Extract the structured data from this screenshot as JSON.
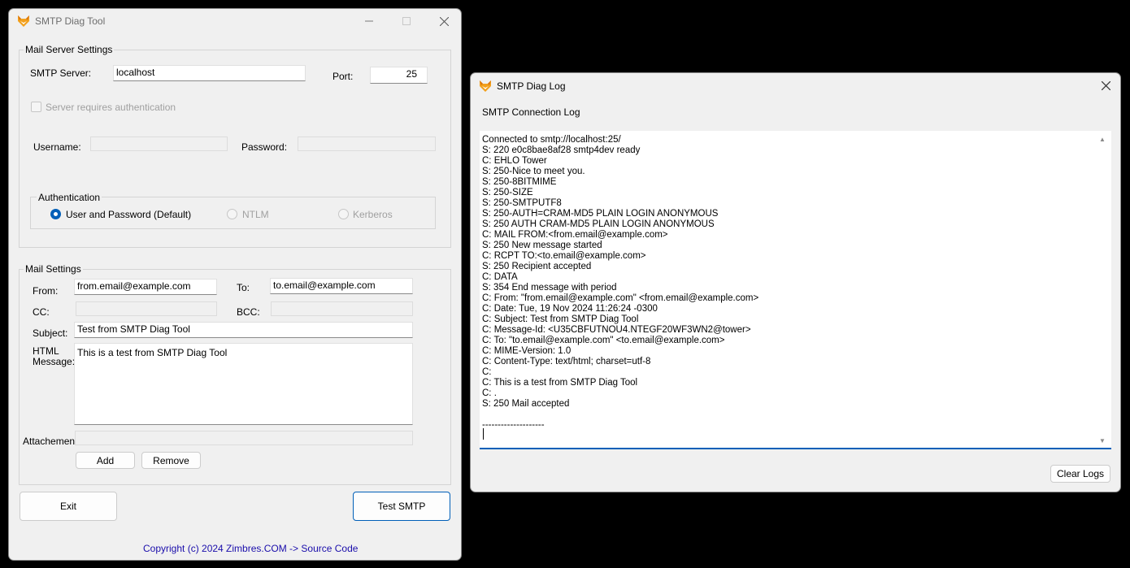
{
  "main_window": {
    "title": "SMTP Diag Tool",
    "server_group": {
      "title": "Mail Server Settings",
      "smtp_server_label": "SMTP Server:",
      "smtp_server_value": "localhost",
      "port_label": "Port:",
      "port_value": "25",
      "auth_checkbox_label": "Server requires authentication",
      "username_label": "Username:",
      "password_label": "Password:",
      "auth_group": {
        "title": "Authentication",
        "options": [
          "User and Password (Default)",
          "NTLM",
          "Kerberos"
        ],
        "selected": "User and Password (Default)"
      }
    },
    "mail_group": {
      "title": "Mail Settings",
      "from_label": "From:",
      "from_value": "from.email@example.com",
      "to_label": "To:",
      "to_value": "to.email@example.com",
      "cc_label": "CC:",
      "bcc_label": "BCC:",
      "subject_label": "Subject:",
      "subject_value": "Test from SMTP Diag Tool",
      "html_label_line1": "HTML",
      "html_label_line2": "Message:",
      "html_value": "This is a test from SMTP Diag Tool",
      "attachment_label": "Attachement:",
      "add_button": "Add",
      "remove_button": "Remove"
    },
    "exit_button": "Exit",
    "test_button": "Test SMTP",
    "footer_link": "Copyright (c) 2024 Zimbres.COM -> Source Code"
  },
  "log_window": {
    "title": "SMTP Diag Log",
    "section_label": "SMTP Connection Log",
    "lines": [
      "Connected to smtp://localhost:25/",
      "S: 220 e0c8bae8af28 smtp4dev ready",
      "C: EHLO Tower",
      "S: 250-Nice to meet you.",
      "S: 250-8BITMIME",
      "S: 250-SIZE",
      "S: 250-SMTPUTF8",
      "S: 250-AUTH=CRAM-MD5 PLAIN LOGIN ANONYMOUS",
      "S: 250 AUTH CRAM-MD5 PLAIN LOGIN ANONYMOUS",
      "C: MAIL FROM:<from.email@example.com>",
      "S: 250 New message started",
      "C: RCPT TO:<to.email@example.com>",
      "S: 250 Recipient accepted",
      "C: DATA",
      "S: 354 End message with period",
      "C: From: \"from.email@example.com\" <from.email@example.com>",
      "C: Date: Tue, 19 Nov 2024 11:26:24 -0300",
      "C: Subject: Test from SMTP Diag Tool",
      "C: Message-Id: <U35CBFUTNOU4.NTEGF20WF3WN2@tower>",
      "C: To: \"to.email@example.com\" <to.email@example.com>",
      "C: MIME-Version: 1.0",
      "C: Content-Type: text/html; charset=utf-8",
      "C:",
      "C: This is a test from SMTP Diag Tool",
      "C: .",
      "S: 250 Mail accepted",
      "",
      "--------------------"
    ],
    "clear_button": "Clear Logs"
  },
  "colors": {
    "accent": "#005fb8",
    "link": "#1a0dab",
    "window_bg": "#f0f0f0",
    "desktop": "#000000"
  },
  "icons": {
    "app": "fox-icon",
    "minimize": "minimize-icon",
    "maximize": "maximize-icon",
    "close": "close-icon"
  }
}
